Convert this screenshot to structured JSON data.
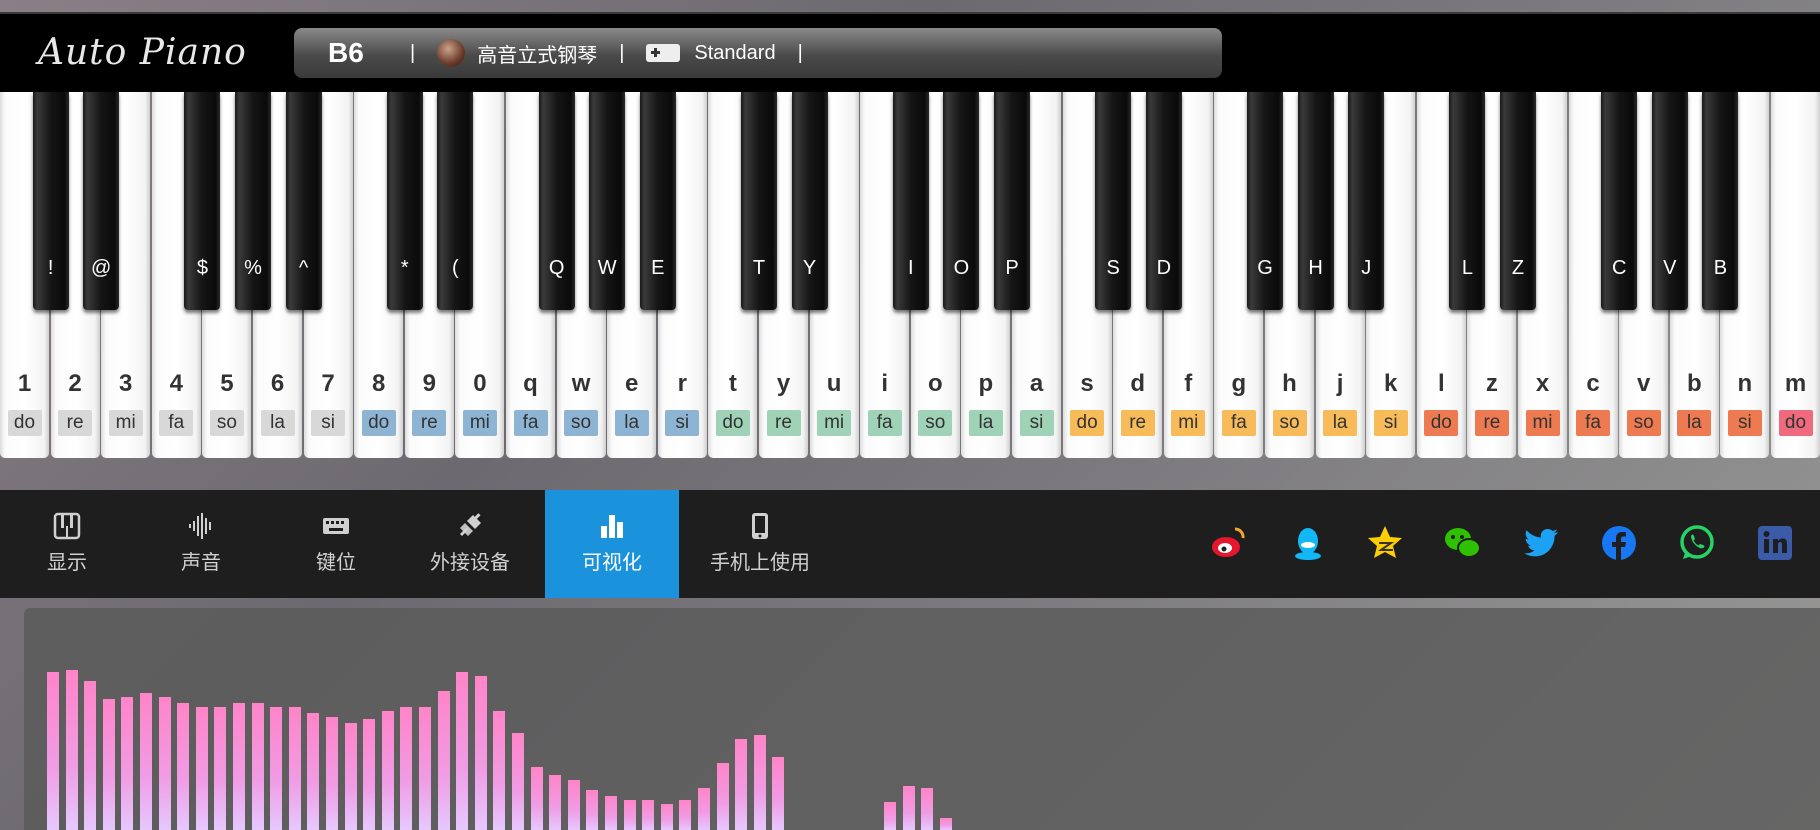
{
  "header": {
    "logo": "Auto Piano",
    "note": "B6",
    "instrument": "高音立式钢琴",
    "keymap": "Standard"
  },
  "keyboard": {
    "white_keys": [
      {
        "key": "1",
        "solf": "do",
        "color": "#d8d8d8"
      },
      {
        "key": "2",
        "solf": "re",
        "color": "#d8d8d8"
      },
      {
        "key": "3",
        "solf": "mi",
        "color": "#d8d8d8"
      },
      {
        "key": "4",
        "solf": "fa",
        "color": "#d8d8d8"
      },
      {
        "key": "5",
        "solf": "so",
        "color": "#d8d8d8"
      },
      {
        "key": "6",
        "solf": "la",
        "color": "#d8d8d8"
      },
      {
        "key": "7",
        "solf": "si",
        "color": "#d8d8d8"
      },
      {
        "key": "8",
        "solf": "do",
        "color": "#8eb4d4"
      },
      {
        "key": "9",
        "solf": "re",
        "color": "#8eb4d4"
      },
      {
        "key": "0",
        "solf": "mi",
        "color": "#8eb4d4"
      },
      {
        "key": "q",
        "solf": "fa",
        "color": "#8eb4d4"
      },
      {
        "key": "w",
        "solf": "so",
        "color": "#8eb4d4"
      },
      {
        "key": "e",
        "solf": "la",
        "color": "#8eb4d4"
      },
      {
        "key": "r",
        "solf": "si",
        "color": "#8eb4d4"
      },
      {
        "key": "t",
        "solf": "do",
        "color": "#9fd2b6"
      },
      {
        "key": "y",
        "solf": "re",
        "color": "#9fd2b6"
      },
      {
        "key": "u",
        "solf": "mi",
        "color": "#9fd2b6"
      },
      {
        "key": "i",
        "solf": "fa",
        "color": "#9fd2b6"
      },
      {
        "key": "o",
        "solf": "so",
        "color": "#9fd2b6"
      },
      {
        "key": "p",
        "solf": "la",
        "color": "#9fd2b6"
      },
      {
        "key": "a",
        "solf": "si",
        "color": "#9fd2b6"
      },
      {
        "key": "s",
        "solf": "do",
        "color": "#f7bb5a"
      },
      {
        "key": "d",
        "solf": "re",
        "color": "#f7bb5a"
      },
      {
        "key": "f",
        "solf": "mi",
        "color": "#f7bb5a"
      },
      {
        "key": "g",
        "solf": "fa",
        "color": "#f7bb5a"
      },
      {
        "key": "h",
        "solf": "so",
        "color": "#f7bb5a"
      },
      {
        "key": "j",
        "solf": "la",
        "color": "#f7bb5a"
      },
      {
        "key": "k",
        "solf": "si",
        "color": "#f7bb5a"
      },
      {
        "key": "l",
        "solf": "do",
        "color": "#ee7a52"
      },
      {
        "key": "z",
        "solf": "re",
        "color": "#ee7a52"
      },
      {
        "key": "x",
        "solf": "mi",
        "color": "#ee7a52"
      },
      {
        "key": "c",
        "solf": "fa",
        "color": "#ee7a52"
      },
      {
        "key": "v",
        "solf": "so",
        "color": "#ee7a52"
      },
      {
        "key": "b",
        "solf": "la",
        "color": "#ee7a52"
      },
      {
        "key": "n",
        "solf": "si",
        "color": "#ee7a52"
      },
      {
        "key": "m",
        "solf": "do",
        "color": "#ee6a7c"
      }
    ],
    "black_keys": [
      {
        "key": "!",
        "slot": 0
      },
      {
        "key": "@",
        "slot": 1
      },
      {
        "key": "$",
        "slot": 3
      },
      {
        "key": "%",
        "slot": 4
      },
      {
        "key": "^",
        "slot": 5
      },
      {
        "key": "*",
        "slot": 7
      },
      {
        "key": "(",
        "slot": 8
      },
      {
        "key": "Q",
        "slot": 10
      },
      {
        "key": "W",
        "slot": 11
      },
      {
        "key": "E",
        "slot": 12
      },
      {
        "key": "T",
        "slot": 14
      },
      {
        "key": "Y",
        "slot": 15
      },
      {
        "key": "I",
        "slot": 17
      },
      {
        "key": "O",
        "slot": 18
      },
      {
        "key": "P",
        "slot": 19
      },
      {
        "key": "S",
        "slot": 21
      },
      {
        "key": "D",
        "slot": 22
      },
      {
        "key": "G",
        "slot": 24
      },
      {
        "key": "H",
        "slot": 25
      },
      {
        "key": "J",
        "slot": 26
      },
      {
        "key": "L",
        "slot": 28
      },
      {
        "key": "Z",
        "slot": 29
      },
      {
        "key": "C",
        "slot": 31
      },
      {
        "key": "V",
        "slot": 32
      },
      {
        "key": "B",
        "slot": 33
      }
    ]
  },
  "toolbar": {
    "items": [
      {
        "label": "显示",
        "icon": "piano-icon",
        "active": false
      },
      {
        "label": "声音",
        "icon": "waveform-icon",
        "active": false
      },
      {
        "label": "键位",
        "icon": "keyboard-icon",
        "active": false
      },
      {
        "label": "外接设备",
        "icon": "plug-icon",
        "active": false
      },
      {
        "label": "可视化",
        "icon": "bar-chart-icon",
        "active": true
      },
      {
        "label": "手机上使用",
        "icon": "phone-icon",
        "active": false
      }
    ],
    "social": [
      {
        "name": "weibo-icon",
        "color": "#e6162d"
      },
      {
        "name": "qq-icon",
        "color": "#12b7f5"
      },
      {
        "name": "qzone-icon",
        "color": "#fece00"
      },
      {
        "name": "wechat-icon",
        "color": "#2dc100"
      },
      {
        "name": "twitter-icon",
        "color": "#1da1f2"
      },
      {
        "name": "facebook-icon",
        "color": "#1877f2"
      },
      {
        "name": "whatsapp-icon",
        "color": "#25d366"
      },
      {
        "name": "linkedin-icon",
        "color": "#3b5aa8"
      }
    ]
  },
  "visualizer": {
    "levels": [
      0.78,
      0.79,
      0.74,
      0.65,
      0.66,
      0.68,
      0.66,
      0.63,
      0.61,
      0.61,
      0.63,
      0.63,
      0.61,
      0.61,
      0.58,
      0.56,
      0.53,
      0.55,
      0.59,
      0.61,
      0.61,
      0.69,
      0.78,
      0.76,
      0.59,
      0.48,
      0.31,
      0.27,
      0.25,
      0.2,
      0.17,
      0.15,
      0.15,
      0.13,
      0.15,
      0.21,
      0.33,
      0.45,
      0.47,
      0.36,
      0,
      0,
      0,
      0,
      0,
      0.14,
      0.22,
      0.21,
      0.06
    ]
  }
}
